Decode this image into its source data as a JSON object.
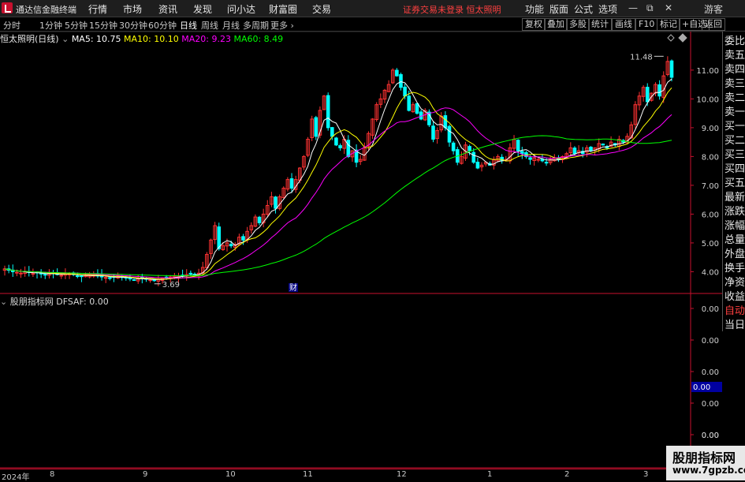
{
  "app": {
    "title": "通达信金融终端"
  },
  "menu": [
    "行情",
    "市场",
    "资讯",
    "发现",
    "问小达",
    "财富圈",
    "交易"
  ],
  "warning": "证券交易未登录  恒太照明",
  "right_menu": [
    "功能",
    "版面",
    "公式",
    "选项"
  ],
  "window_buttons": {
    "restore": "⧉",
    "user": "游客"
  },
  "periods": [
    "分时",
    "1分钟",
    "5分钟",
    "15分钟",
    "30分钟",
    "60分钟",
    "日线",
    "周线",
    "月线",
    "多周期",
    "更多"
  ],
  "active_period": "日线",
  "right_tools": [
    "复权",
    "叠加",
    "多股",
    "统计",
    "画线",
    "F10",
    "标记",
    "+自选",
    "返回"
  ],
  "main_header": {
    "stock": "恒太照明(日线)",
    "ma5": "MA5: 10.75",
    "ma10": "MA10: 10.10",
    "ma20": "MA20: 9.23",
    "ma60": "MA60: 8.49"
  },
  "colors": {
    "up": "#ff3232",
    "down": "#00ffff",
    "ma5": "#ffffff",
    "ma10": "#ffff00",
    "ma20": "#ff00ff",
    "ma60": "#00ff00",
    "border": "#c8102e"
  },
  "price_axis": [
    "11.00",
    "10.00",
    "9.00",
    "8.00",
    "7.00",
    "6.00",
    "5.00",
    "4.00"
  ],
  "annotations": {
    "high": "11.48",
    "low": "3.69",
    "cai": "财"
  },
  "side_panel": [
    "委比",
    "卖五",
    "卖四",
    "卖三",
    "卖二",
    "卖一",
    "买一",
    "买二",
    "买三",
    "买四",
    "买五",
    "最新",
    "涨跌",
    "涨幅",
    "总量",
    "外盘",
    "换手",
    "净资",
    "收益",
    "自动",
    "当日"
  ],
  "sub_header": {
    "name": "股朋指标网",
    "value": "DFSAF: 0.00"
  },
  "sub_axis": [
    "0.00",
    "0.00",
    "0.00",
    "0.00",
    "0.00",
    "0.00"
  ],
  "sub_highlight": "0.00",
  "time_axis": [
    "2024年",
    "8",
    "9",
    "10",
    "11",
    "12",
    "1",
    "2",
    "3"
  ],
  "watermark": {
    "line1": "股朋指标网",
    "line2": "www.7gpzb.com"
  },
  "chart_data": {
    "type": "candlestick",
    "ylim": [
      3.3,
      11.9
    ],
    "low_point": 3.69,
    "high_point": 11.48,
    "closes": [
      4.1,
      4.05,
      4.0,
      3.98,
      3.95,
      4.0,
      3.97,
      3.94,
      3.96,
      3.92,
      3.9,
      3.93,
      3.95,
      3.9,
      3.88,
      3.92,
      3.94,
      3.9,
      3.85,
      3.83,
      3.86,
      3.9,
      3.88,
      3.85,
      3.82,
      3.8,
      3.78,
      3.82,
      3.85,
      3.8,
      3.78,
      3.75,
      3.72,
      3.75,
      3.78,
      3.74,
      3.72,
      3.69,
      3.74,
      3.78,
      3.8,
      3.82,
      3.85,
      3.83,
      3.88,
      3.9,
      3.92,
      3.88,
      3.95,
      4.15,
      4.6,
      5.1,
      5.6,
      4.8,
      4.9,
      5.0,
      4.9,
      4.95,
      5.2,
      5.1,
      5.4,
      5.6,
      5.9,
      5.7,
      6.0,
      6.3,
      6.6,
      6.2,
      6.6,
      6.9,
      7.2,
      6.9,
      7.2,
      7.6,
      8.0,
      8.6,
      9.3,
      8.7,
      9.6,
      10.1,
      9.0,
      8.7,
      8.4,
      8.3,
      8.6,
      8.0,
      8.2,
      7.8,
      7.9,
      8.3,
      8.8,
      9.3,
      9.8,
      10.0,
      10.3,
      10.5,
      11.0,
      10.8,
      10.4,
      10.1,
      9.6,
      9.8,
      9.5,
      9.3,
      9.6,
      9.1,
      8.6,
      8.9,
      9.4,
      9.0,
      8.5,
      8.2,
      7.8,
      8.0,
      8.4,
      8.2,
      7.8,
      7.6,
      7.7,
      7.8,
      7.7,
      7.9,
      8.0,
      7.85,
      7.9,
      8.3,
      8.6,
      8.2,
      8.1,
      8.0,
      7.9,
      7.95,
      7.9,
      7.85,
      7.8,
      7.9,
      7.95,
      7.9,
      8.0,
      8.1,
      8.3,
      8.1,
      8.2,
      8.1,
      8.3,
      8.2,
      8.3,
      8.45,
      8.4,
      8.3,
      8.5,
      8.4,
      8.6,
      8.5,
      8.7,
      9.1,
      9.8,
      10.1,
      10.4,
      9.9,
      10.2,
      10.5,
      10.1,
      10.8,
      11.3,
      10.75
    ],
    "ma": [
      {
        "name": "MA5",
        "value": 10.75
      },
      {
        "name": "MA10",
        "value": 10.1
      },
      {
        "name": "MA20",
        "value": 9.23
      },
      {
        "name": "MA60",
        "value": 8.49
      }
    ],
    "sub_indicator": {
      "name": "DFSAF",
      "value": 0.0
    }
  }
}
